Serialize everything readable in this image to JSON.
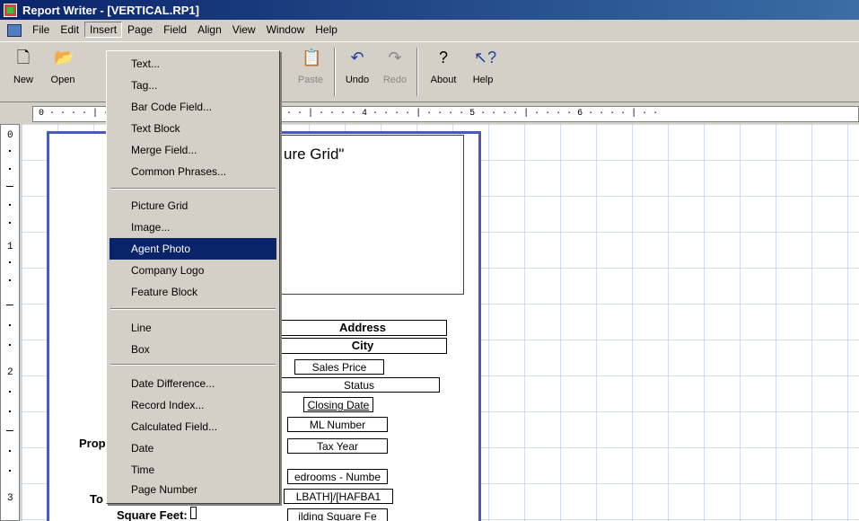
{
  "window": {
    "title": "Report Writer - [VERTICAL.RP1]"
  },
  "menubar": {
    "items": [
      "File",
      "Edit",
      "Insert",
      "Page",
      "Field",
      "Align",
      "View",
      "Window",
      "Help"
    ]
  },
  "toolbar": {
    "new": "New",
    "open": "Open",
    "copy": "y",
    "paste": "Paste",
    "undo": "Undo",
    "redo": "Redo",
    "about": "About",
    "help": "Help"
  },
  "ruler": {
    "h_text": "0 · · · · | · · · · · · · · · · · · · · 3 · · · · | · · · · 4 · · · · | · · · · 5 · · · · | · · · · 6 · · · · | · ·",
    "v_numbers": [
      "0",
      "1",
      "2",
      "3"
    ]
  },
  "insert_menu": {
    "items": [
      "Text...",
      "Tag...",
      "Bar Code Field...",
      "Text Block",
      "Merge Field...",
      "Common Phrases...",
      "Picture Grid",
      "Image...",
      "Agent Photo",
      "Company Logo",
      "Feature Block",
      "Line",
      "Box",
      "Date Difference...",
      "Record Index...",
      "Calculated Field...",
      "Date",
      "Time",
      "Page Number"
    ],
    "highlighted": "Agent Photo"
  },
  "page": {
    "picture_label": "ure Grid\"",
    "fields": {
      "address": "Address",
      "city": "City",
      "sales_price": "Sales Price",
      "status": "Status",
      "closing_date": "Closing Date",
      "ml_number": "ML Number",
      "tax_year": "Tax Year",
      "bedrooms": "edrooms - Numbe",
      "baths": "LBATH]/[HAFBA1",
      "building_sqft": "ilding Square Fe"
    },
    "labels": {
      "prop": "Prop",
      "to": "To",
      "square_feet": "Square Feet:"
    }
  },
  "colors": {
    "title_bar": "#0a246a",
    "highlight": "#0a246a",
    "page_border": "#4a5cb8"
  }
}
